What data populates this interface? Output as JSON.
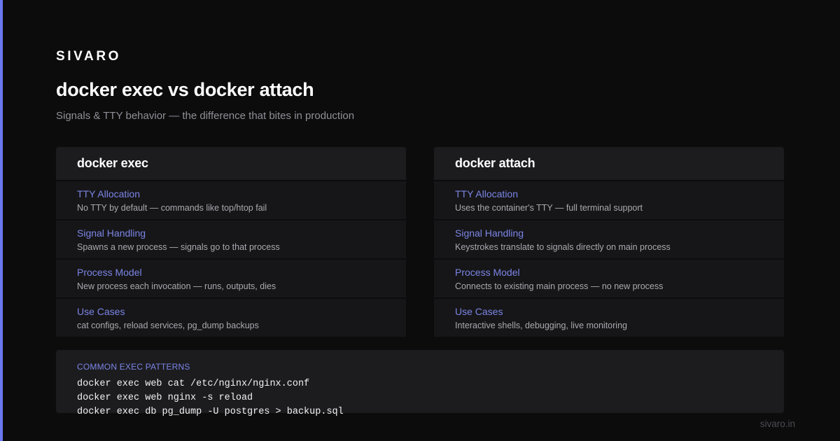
{
  "brand": "SIVARO",
  "title": "docker exec vs docker attach",
  "subtitle": "Signals & TTY behavior — the difference that bites in production",
  "panels": [
    {
      "heading": "docker exec",
      "rows": [
        {
          "title": "TTY Allocation",
          "desc": "No TTY by default — commands like top/htop fail"
        },
        {
          "title": "Signal Handling",
          "desc": "Spawns a new process — signals go to that process"
        },
        {
          "title": "Process Model",
          "desc": "New process each invocation — runs, outputs, dies"
        },
        {
          "title": "Use Cases",
          "desc": "cat configs, reload services, pg_dump backups"
        }
      ]
    },
    {
      "heading": "docker attach",
      "rows": [
        {
          "title": "TTY Allocation",
          "desc": "Uses the container's TTY — full terminal support"
        },
        {
          "title": "Signal Handling",
          "desc": "Keystrokes translate to signals directly on main process"
        },
        {
          "title": "Process Model",
          "desc": "Connects to existing main process — no new process"
        },
        {
          "title": "Use Cases",
          "desc": "Interactive shells, debugging, live monitoring"
        }
      ]
    }
  ],
  "patterns": {
    "label": "COMMON EXEC PATTERNS",
    "lines": [
      "docker exec web cat /etc/nginx/nginx.conf",
      "docker exec web nginx -s reload",
      "docker exec db pg_dump -U postgres > backup.sql"
    ]
  },
  "footer": "sivaro.in",
  "colors": {
    "background": "#0c0c0d",
    "accent": "#6b78f0",
    "row_title": "#7b85e6",
    "panel": "#1c1c1f"
  }
}
